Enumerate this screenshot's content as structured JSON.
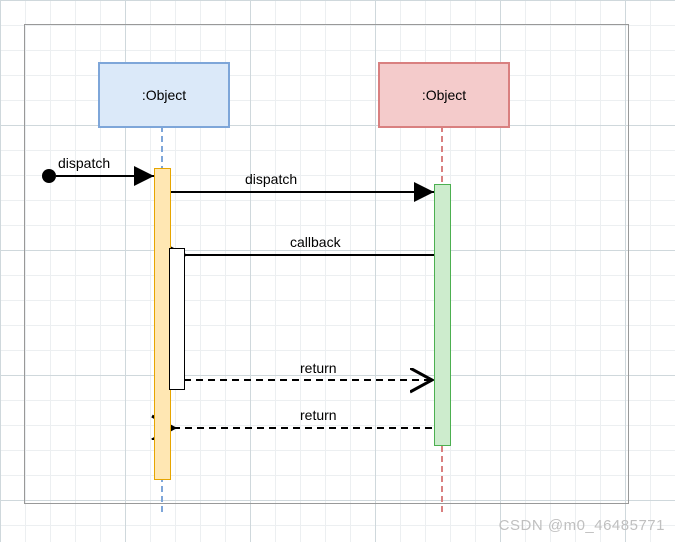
{
  "participants": {
    "left": {
      "label": ":Object"
    },
    "right": {
      "label": ":Object"
    }
  },
  "messages": {
    "start_dispatch": "dispatch",
    "dispatch": "dispatch",
    "callback": "callback",
    "inner_return": "return",
    "outer_return": "return"
  },
  "watermark": "CSDN @m0_46485771",
  "chart_data": {
    "type": "diagram",
    "diagram_kind": "uml-sequence",
    "participants": [
      {
        "id": "left",
        "name": ":Object"
      },
      {
        "id": "right",
        "name": ":Object"
      }
    ],
    "activations": [
      {
        "on": "left",
        "id": "L1",
        "start": 1,
        "end": 9
      },
      {
        "on": "right",
        "id": "R1",
        "start": 2,
        "end": 8
      },
      {
        "on": "left",
        "id": "L2",
        "start": 3,
        "end": 6,
        "nested_in": "L1"
      }
    ],
    "messages": [
      {
        "from": "start",
        "to": "left",
        "label": "dispatch",
        "kind": "sync",
        "order": 1
      },
      {
        "from": "left",
        "to": "right",
        "label": "dispatch",
        "kind": "sync",
        "order": 2
      },
      {
        "from": "right",
        "to": "left",
        "label": "callback",
        "kind": "sync",
        "order": 3
      },
      {
        "from": "left",
        "to": "right",
        "label": "return",
        "kind": "return",
        "order": 6
      },
      {
        "from": "right",
        "to": "left",
        "label": "return",
        "kind": "return",
        "order": 8
      }
    ]
  }
}
